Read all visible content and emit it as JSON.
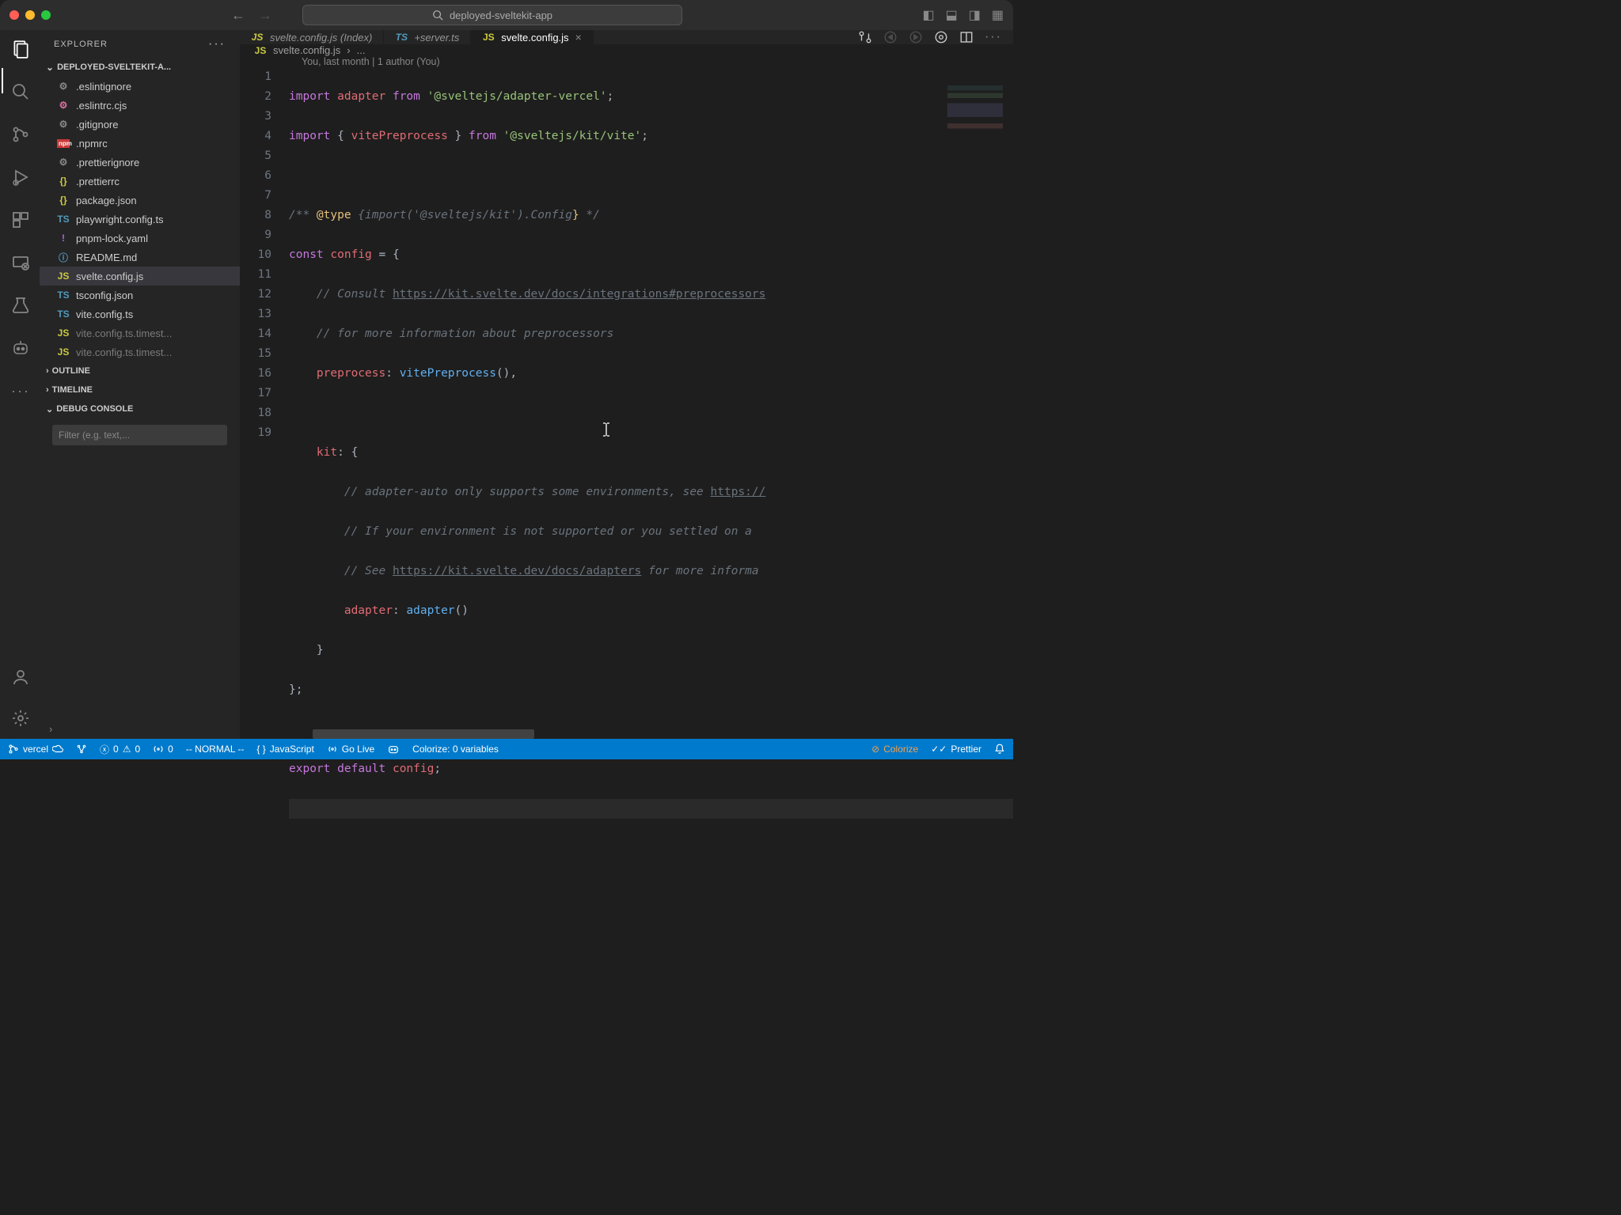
{
  "window": {
    "search_text": "deployed-sveltekit-app"
  },
  "explorer": {
    "title": "EXPLORER",
    "project": "DEPLOYED-SVELTEKIT-A...",
    "files": [
      {
        "icon": "gear",
        "iconClass": "fi-gear",
        "label": ".eslintignore"
      },
      {
        "icon": "gear",
        "iconClass": "fi-pink",
        "label": ".eslintrc.cjs"
      },
      {
        "icon": "gear",
        "iconClass": "fi-gear",
        "label": ".gitignore"
      },
      {
        "icon": "npm",
        "iconClass": "fi-npm",
        "label": ".npmrc"
      },
      {
        "icon": "gear",
        "iconClass": "fi-gear",
        "label": ".prettierignore"
      },
      {
        "icon": "{}",
        "iconClass": "fi-json",
        "label": ".prettierrc"
      },
      {
        "icon": "{}",
        "iconClass": "fi-json",
        "label": "package.json"
      },
      {
        "icon": "TS",
        "iconClass": "fi-ts",
        "label": "playwright.config.ts"
      },
      {
        "icon": "!",
        "iconClass": "fi-lock",
        "label": "pnpm-lock.yaml"
      },
      {
        "icon": "ⓘ",
        "iconClass": "fi-md",
        "label": "README.md"
      },
      {
        "icon": "JS",
        "iconClass": "fi-js",
        "label": "svelte.config.js",
        "active": true
      },
      {
        "icon": "TS",
        "iconClass": "fi-ts",
        "label": "tsconfig.json"
      },
      {
        "icon": "TS",
        "iconClass": "fi-ts",
        "label": "vite.config.ts"
      },
      {
        "icon": "JS",
        "iconClass": "fi-js",
        "label": "vite.config.ts.timest...",
        "dim": true
      },
      {
        "icon": "JS",
        "iconClass": "fi-js",
        "label": "vite.config.ts.timest...",
        "dim": true
      }
    ],
    "sections": {
      "outline": "OUTLINE",
      "timeline": "TIMELINE",
      "debug": "DEBUG CONSOLE"
    },
    "filter_placeholder": "Filter (e.g. text,..."
  },
  "tabs": [
    {
      "icon": "JS",
      "iconClass": "fi-js",
      "label": "svelte.config.js (Index)",
      "italic": true
    },
    {
      "icon": "TS",
      "iconClass": "fi-ts",
      "label": "+server.ts",
      "italic": true
    },
    {
      "icon": "JS",
      "iconClass": "fi-js",
      "label": "svelte.config.js",
      "active": true,
      "close": true
    }
  ],
  "breadcrumb": {
    "file": "svelte.config.js",
    "rest": "..."
  },
  "codelens": "You, last month | 1 author (You)",
  "code": {
    "lines": [
      1,
      2,
      3,
      4,
      5,
      6,
      7,
      8,
      9,
      10,
      11,
      12,
      13,
      14,
      15,
      16,
      17,
      18,
      19
    ]
  },
  "status": {
    "branch": "vercel",
    "errors": "0",
    "warnings": "0",
    "ports": "0",
    "mode": "-- NORMAL --",
    "lang": "JavaScript",
    "golive": "Go Live",
    "colorize_vars": "Colorize: 0 variables",
    "colorize": "Colorize",
    "prettier": "Prettier"
  }
}
